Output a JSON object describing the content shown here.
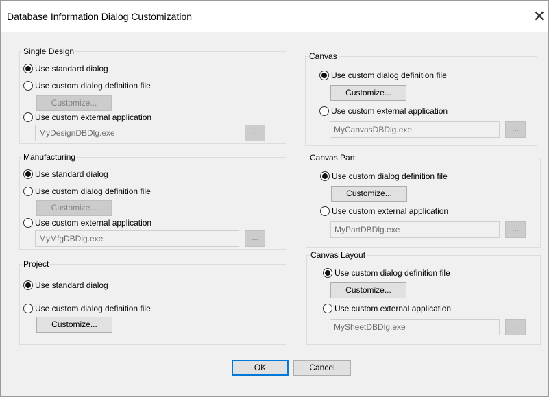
{
  "window": {
    "title": "Database Information Dialog Customization",
    "close_glyph": "✕"
  },
  "groups": {
    "single_design": {
      "legend": "Single Design",
      "opt_standard": "Use standard dialog",
      "opt_custom_def": "Use custom dialog definition file",
      "customize": "Customize...",
      "opt_external": "Use custom external application",
      "exe": "MyDesignDBDlg.exe",
      "browse": "...",
      "selected": "standard"
    },
    "manufacturing": {
      "legend": "Manufacturing",
      "opt_standard": "Use standard dialog",
      "opt_custom_def": "Use custom dialog definition file",
      "customize": "Customize...",
      "opt_external": "Use custom external application",
      "exe": "MyMfgDBDlg.exe",
      "browse": "...",
      "selected": "standard"
    },
    "project": {
      "legend": "Project",
      "opt_standard": "Use standard dialog",
      "opt_custom_def": "Use custom dialog definition file",
      "customize": "Customize...",
      "selected": "standard"
    },
    "canvas": {
      "legend": "Canvas",
      "opt_custom_def": "Use custom dialog definition file",
      "customize": "Customize...",
      "opt_external": "Use custom external application",
      "exe": "MyCanvasDBDlg.exe",
      "browse": "...",
      "selected": "custom_def"
    },
    "canvas_part": {
      "legend": "Canvas Part",
      "opt_custom_def": "Use custom dialog definition file",
      "customize": "Customize...",
      "opt_external": "Use custom external application",
      "exe": "MyPartDBDlg.exe",
      "browse": "...",
      "selected": "custom_def"
    },
    "canvas_layout": {
      "legend": "Canvas Layout",
      "opt_custom_def": "Use custom dialog definition file",
      "customize": "Customize...",
      "opt_external": "Use custom external application",
      "exe": "MySheetDBDlg.exe",
      "browse": "...",
      "selected": "custom_def"
    }
  },
  "buttons": {
    "ok": "OK",
    "cancel": "Cancel"
  },
  "colors": {
    "dialog_bg": "#f0f0f0",
    "default_button_border": "#0078d7",
    "disabled_text": "#838383"
  },
  "icons": {
    "close": "close-icon",
    "radio_checked": "radio-checked",
    "radio_unchecked": "radio-unchecked"
  }
}
